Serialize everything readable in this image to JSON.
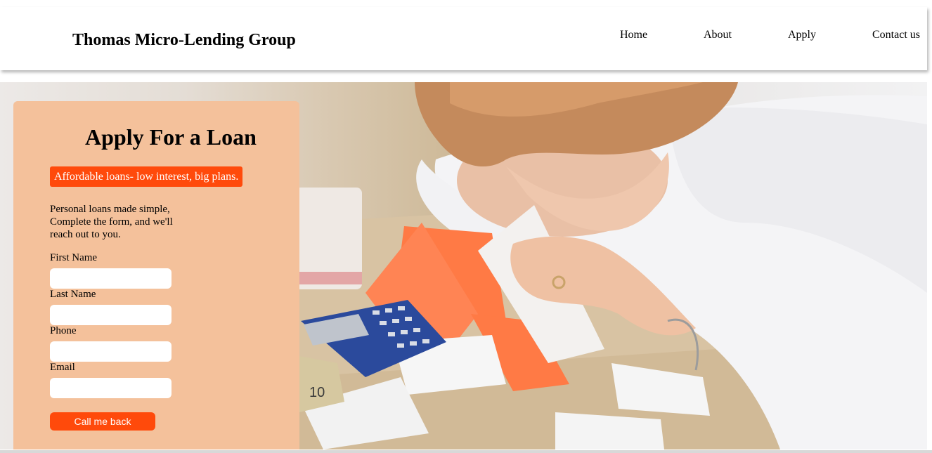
{
  "header": {
    "brand": "Thomas Micro-Lending Group",
    "nav": [
      {
        "label": "Home"
      },
      {
        "label": "About"
      },
      {
        "label": "Apply"
      },
      {
        "label": "Contact us"
      }
    ]
  },
  "form": {
    "title": "Apply For a Loan",
    "tagline": "Affordable loans- low interest, big plans.",
    "intro": "Personal loans made simple, Complete the form, and we'll reach out to you.",
    "fields": [
      {
        "label": "First Name",
        "value": ""
      },
      {
        "label": "Last Name",
        "value": ""
      },
      {
        "label": "Phone",
        "value": ""
      },
      {
        "label": "Email",
        "value": ""
      }
    ],
    "submit_label": "Call me back"
  },
  "hero": {
    "image_description_icon": "stressed-woman-with-bills-photo",
    "calculator_display": "",
    "banknote_number": "10"
  },
  "colors": {
    "panel_bg": "#f4c19b",
    "accent": "#ff4a0b",
    "header_bg": "#ffffff"
  }
}
